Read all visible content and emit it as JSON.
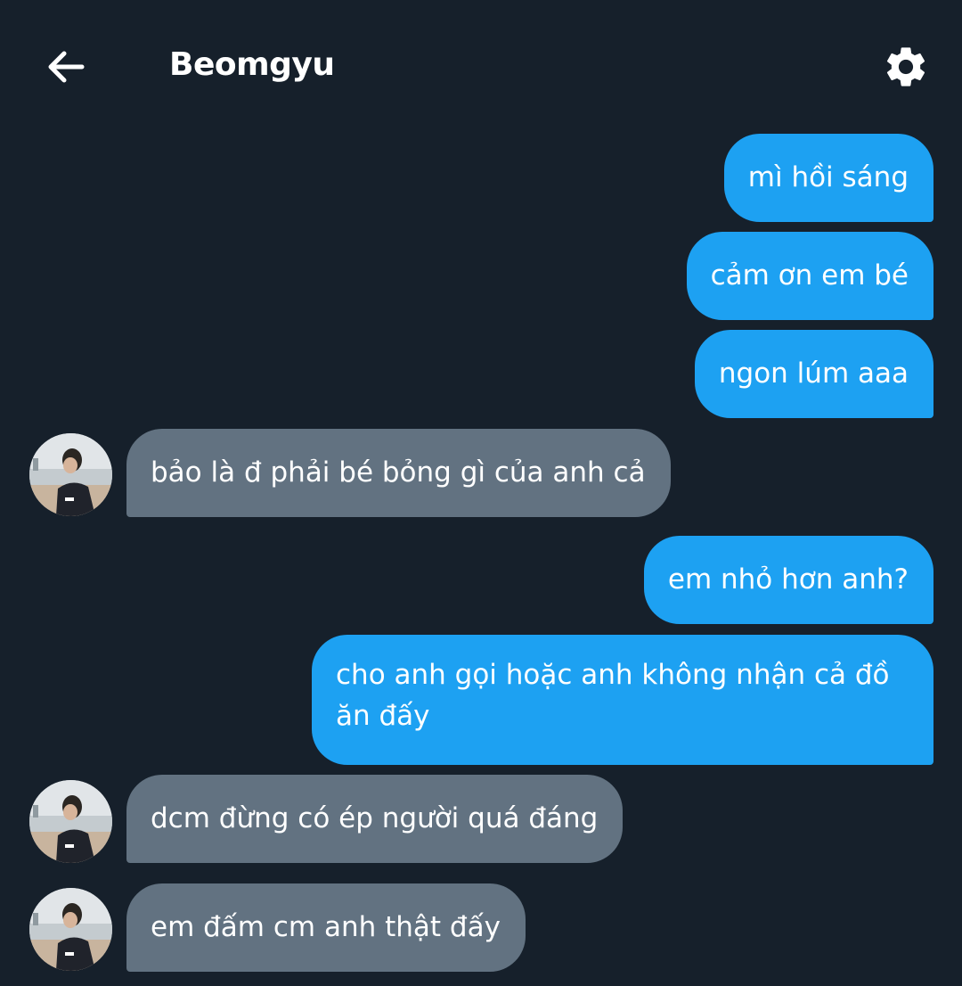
{
  "header": {
    "back_icon": "arrow-left-icon",
    "title": "Beomgyu",
    "settings_icon": "gear-icon"
  },
  "colors": {
    "background": "#16202b",
    "sent_bubble": "#1da1f2",
    "received_bubble": "#627281",
    "text": "#ffffff"
  },
  "messages": [
    {
      "direction": "sent",
      "text": "mì hồi sáng"
    },
    {
      "direction": "sent",
      "text": "cảm ơn em bé"
    },
    {
      "direction": "sent",
      "text": "ngon lúm aaa"
    },
    {
      "direction": "received",
      "text": "bảo là đ phải bé bỏng gì của anh cả",
      "avatar": true
    },
    {
      "direction": "sent",
      "text": "em nhỏ hơn anh?"
    },
    {
      "direction": "sent",
      "text": "cho anh gọi hoặc anh không nhận cả đồ ăn đấy"
    },
    {
      "direction": "received",
      "text": "dcm đừng có ép người quá đáng",
      "avatar": true
    },
    {
      "direction": "received",
      "text": "em đấm cm anh thật đấy",
      "avatar": true
    }
  ]
}
